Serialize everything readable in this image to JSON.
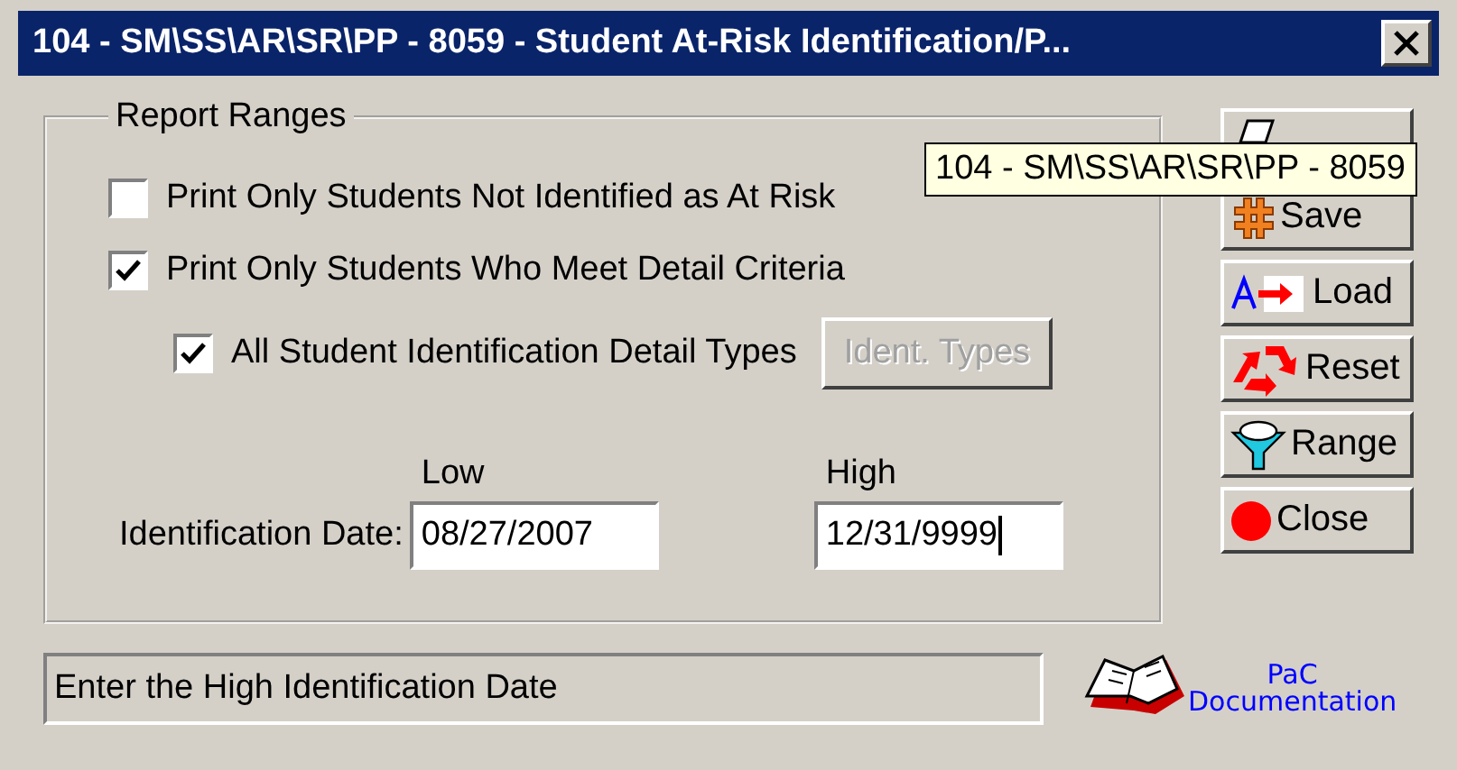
{
  "window": {
    "title": "104 - SM\\SS\\AR\\SR\\PP - 8059 - Student At-Risk Identification/P..."
  },
  "report_ranges": {
    "legend": "Report Ranges",
    "options": [
      {
        "label": "Print Only Students Not Identified as At Risk",
        "checked": false
      },
      {
        "label": "Print Only Students Who Meet Detail Criteria",
        "checked": true,
        "children": [
          {
            "label": "All Student Identification Detail Types",
            "checked": true
          }
        ]
      }
    ],
    "ident_types_button": {
      "label": "Ident. Types",
      "disabled": true
    },
    "date_label": "Identification Date:",
    "date_fields": [
      {
        "heading": "Low",
        "value": "08/27/2007",
        "focused": false
      },
      {
        "heading": "High",
        "value": "12/31/9999",
        "focused": true
      }
    ]
  },
  "buttons": [
    {
      "kind": "print"
    },
    {
      "kind": "save",
      "label": "Save"
    },
    {
      "kind": "load",
      "label": "Load"
    },
    {
      "kind": "reset",
      "label": "Reset"
    },
    {
      "kind": "range",
      "label": "Range"
    },
    {
      "kind": "close",
      "label": "Close"
    }
  ],
  "tooltip": "104 - SM\\SS\\AR\\SR\\PP - 8059",
  "status_bar": "Enter the High Identification Date",
  "documentation_link": {
    "line_1": "PaC",
    "line_2": "Documentation"
  }
}
